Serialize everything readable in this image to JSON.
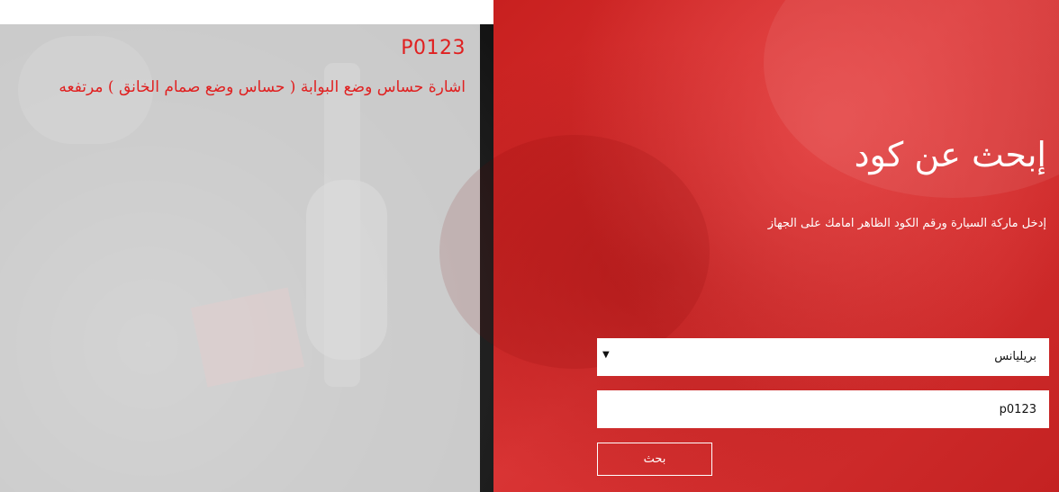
{
  "result": {
    "code": "P0123",
    "description": "اشارة حساس وضع البوابة ( حساس وضع صمام الخانق ) مرتفعه"
  },
  "search": {
    "title": "إبحث عن كود",
    "subtitle": "إدخل ماركة السيارة ورقم الكود الظاهر امامك على الجهاز",
    "brand_select_value": "بريليانس",
    "code_input_value": "p0123",
    "button_label": "بحث"
  },
  "colors": {
    "accent_red": "#e02020",
    "panel_red": "#c8201f"
  }
}
